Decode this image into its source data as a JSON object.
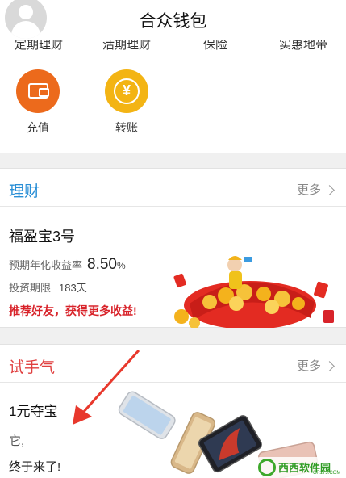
{
  "header": {
    "title": "合众钱包"
  },
  "nav": {
    "items": [
      "定期理财",
      "活期理财",
      "保险",
      "实惠地带"
    ]
  },
  "actions": [
    {
      "label": "充值",
      "icon": "wallet-icon",
      "color": "#ec6a1c"
    },
    {
      "label": "转账",
      "icon": "yen-transfer-icon",
      "color": "#f3b414"
    }
  ],
  "licai": {
    "title": "理财",
    "more": "更多",
    "product": {
      "name": "福盈宝3号",
      "rate_label": "预期年化收益率",
      "rate_value": "8.50",
      "rate_unit": "%",
      "term_label": "投资期限",
      "term_value": "183天",
      "promo": "推荐好友，获得更多收益!"
    }
  },
  "shishouqi": {
    "title": "试手气",
    "more": "更多",
    "product": {
      "name": "1元夺宝",
      "line1": "它,",
      "line2": "终于来了!"
    }
  },
  "watermark": {
    "text": "西西软件园",
    "sub": "CR173.COM"
  },
  "colors": {
    "accent_blue": "#2a8fd6",
    "accent_red": "#e04040",
    "promo_red": "#d8232a",
    "arrow_red": "#e8382c"
  }
}
